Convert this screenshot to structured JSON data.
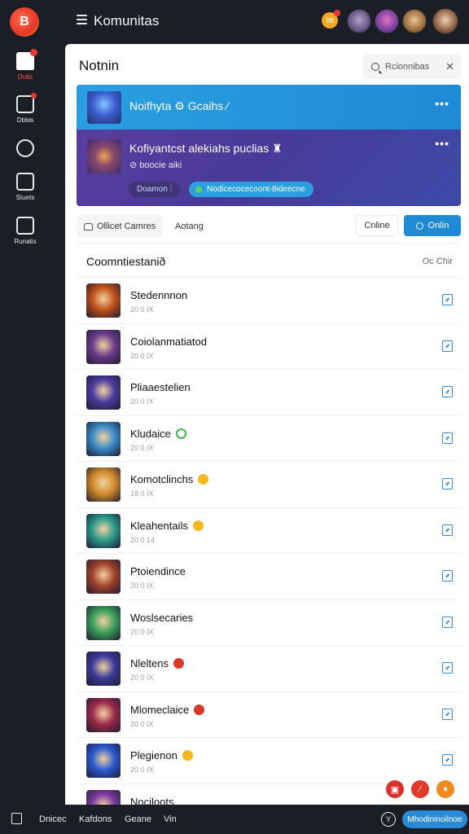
{
  "app": {
    "logo_letter": "B",
    "title": "Komunitas",
    "badge_glyph": "✉"
  },
  "sidebar": {
    "items": [
      {
        "label": "Dutis",
        "icon": "home-icon",
        "active": true
      },
      {
        "label": "Dbbis",
        "icon": "inbox-icon"
      },
      {
        "label": "",
        "icon": "refresh-icon"
      },
      {
        "label": "Stuets",
        "icon": "store-icon"
      },
      {
        "label": "Runatis",
        "icon": "chart-icon"
      }
    ]
  },
  "panel": {
    "title": "Notnin",
    "search_placeholder": "Rcionnibas",
    "close_glyph": "✕"
  },
  "notification": {
    "header_text": "Noifhyta ⚙ Gcaihs ⁄",
    "more_glyph": "•••",
    "message": "Kofiyantcst alekiahs puclias ♜",
    "sub": "⊘ boocie aiki",
    "chip_left": "Doamon ⫶",
    "chip_right": "Nodicecocecoont-8ideecne"
  },
  "filters": {
    "chip1": "Ollicet Camres",
    "chip2": "Aotang",
    "online_plain": "Cnline",
    "online_primary": "Onlin"
  },
  "list": {
    "title": "Coomntiestanið",
    "sort": "Oc Chir",
    "rows": [
      {
        "name": "Stedennnon",
        "meta": "20 0 IX",
        "status": "none",
        "color": "#c0501a"
      },
      {
        "name": "Coiolanmatiatod",
        "meta": "20 0 IX",
        "status": "none",
        "color": "#6a3a8a"
      },
      {
        "name": "Pliaaestelien",
        "meta": "20 0 IX",
        "status": "none",
        "color": "#4a3aa0"
      },
      {
        "name": "Kludaice",
        "meta": "20 0 IX",
        "status": "green",
        "color": "#3a8ac8"
      },
      {
        "name": "Komotclinchs",
        "meta": "18 0 IX",
        "status": "yellow",
        "color": "#d08a2a"
      },
      {
        "name": "Kleahentails",
        "meta": "20 0 14",
        "status": "yellow",
        "color": "#2a9a8a"
      },
      {
        "name": "Ptoiendince",
        "meta": "20 0 IX",
        "status": "none",
        "color": "#a0402a"
      },
      {
        "name": "Woslsecaries",
        "meta": "20 0 IX",
        "status": "none",
        "color": "#3aa05a"
      },
      {
        "name": "Nleltens",
        "meta": "20 0 IX",
        "status": "red",
        "color": "#3a3a9a"
      },
      {
        "name": "Mlomeclaice",
        "meta": "20 0 IX",
        "status": "red",
        "color": "#9a2a4a"
      },
      {
        "name": "Plegienon",
        "meta": "20 0 IX",
        "status": "yellow",
        "color": "#2a5ad0"
      },
      {
        "name": "Nociloots",
        "meta": "",
        "status": "none",
        "color": "#7a3aa0"
      }
    ]
  },
  "fabs": [
    {
      "glyph": "▣",
      "color": "#d8302a"
    },
    {
      "glyph": "⁄",
      "color": "#e03a2a"
    },
    {
      "glyph": "♦",
      "color": "#f08a1e"
    }
  ],
  "bottom": {
    "links": [
      "Dnicec",
      "Kafdons",
      "Geane",
      "Vin"
    ],
    "circle_glyph": "Y",
    "button": "Mhodininoilnoe"
  }
}
